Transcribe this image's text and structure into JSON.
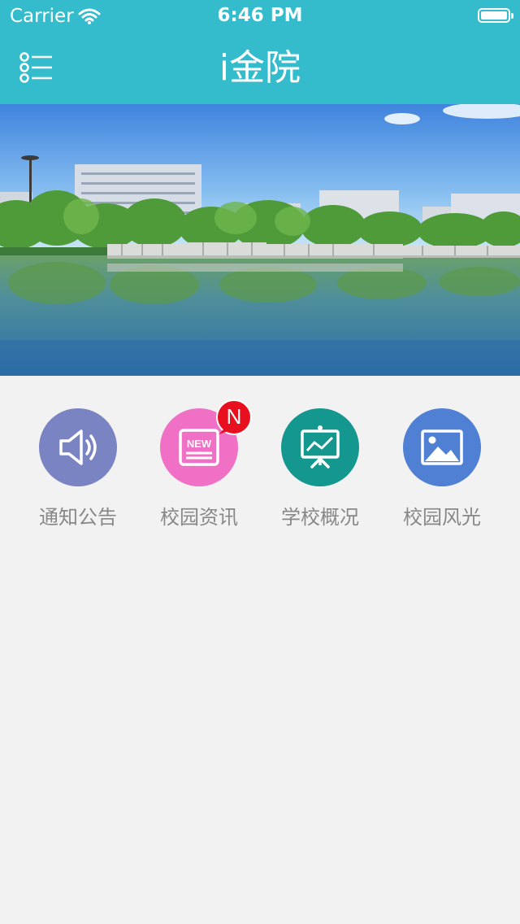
{
  "status_bar": {
    "carrier": "Carrier",
    "time": "6:46 PM"
  },
  "nav": {
    "title": "i金院",
    "bg_color": "#34bccd",
    "menu_icon": "list-menu-icon"
  },
  "hero": {
    "alt": "campus lake photo"
  },
  "grid": [
    {
      "label": "通知公告",
      "icon": "speaker-icon",
      "color": "#7b84c3"
    },
    {
      "label": "校园资讯",
      "icon": "news-icon",
      "color": "#ef70c4",
      "badge": "N"
    },
    {
      "label": "学校概况",
      "icon": "presentation-icon",
      "color": "#14978f"
    },
    {
      "label": "校园风光",
      "icon": "image-icon",
      "color": "#4f80d3"
    }
  ]
}
